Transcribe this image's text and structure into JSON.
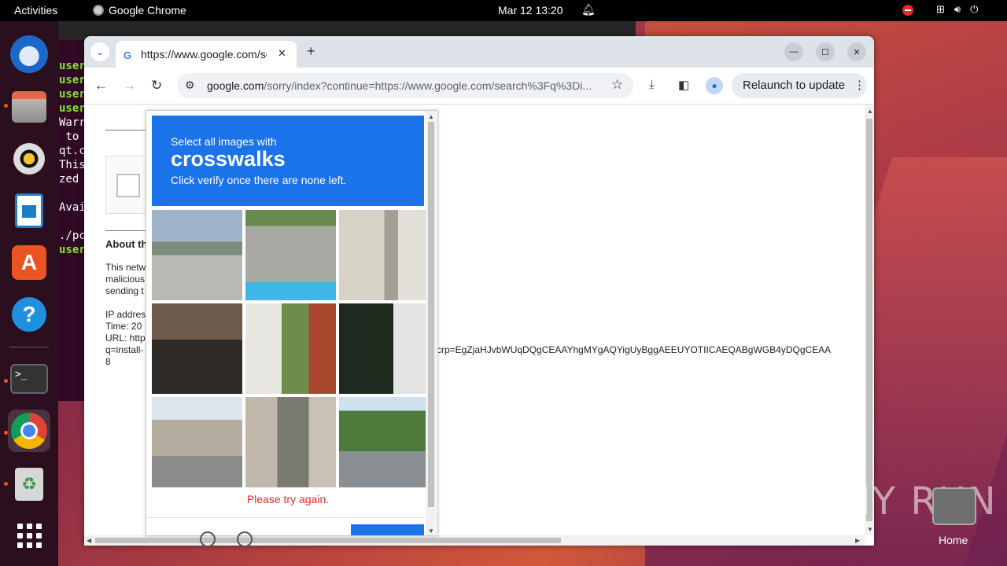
{
  "topbar": {
    "activities": "Activities",
    "app_name": "Google Chrome",
    "clock": "Mar 12  13:20"
  },
  "dock": {
    "items": [
      "thunderbird-icon",
      "files-icon",
      "rhythmbox-icon",
      "writer-icon",
      "app-center-icon",
      "help-icon",
      "terminal-icon",
      "chrome-icon",
      "trash-icon",
      "show-apps-icon"
    ]
  },
  "terminal": {
    "lines": [
      "user",
      "user",
      "user",
      "user",
      "Warr",
      " to",
      "qt.c",
      "This",
      "zed",
      "",
      "Avai",
      "",
      "./pc",
      "user"
    ]
  },
  "browser": {
    "tab_title": "https://www.google.com/sorry",
    "url_domain": "google.com",
    "url_path": "/sorry/index?continue=https://www.google.com/search%3Fq%3Di...",
    "relaunch_label": "Relaunch to update"
  },
  "page": {
    "about": "About th",
    "p1": [
      "This netw",
      "malicious",
      "sending t"
    ],
    "p2": [
      "IP addres",
      "Time: 20",
      "URL: http",
      "q=install-",
      "8"
    ],
    "crp": "crp=EgZjaHJvbWUqDQgCEAAYhgMYgAQYigUyBggAEEUYOTIICAEQABgWGB4yDQgCEAA"
  },
  "captcha": {
    "line1": "Select all images with",
    "keyword": "crosswalks",
    "line3": "Click verify once there are none left.",
    "error": "Please try again."
  },
  "desktop": {
    "watermark": "ANY RUN",
    "home_label": "Home"
  }
}
